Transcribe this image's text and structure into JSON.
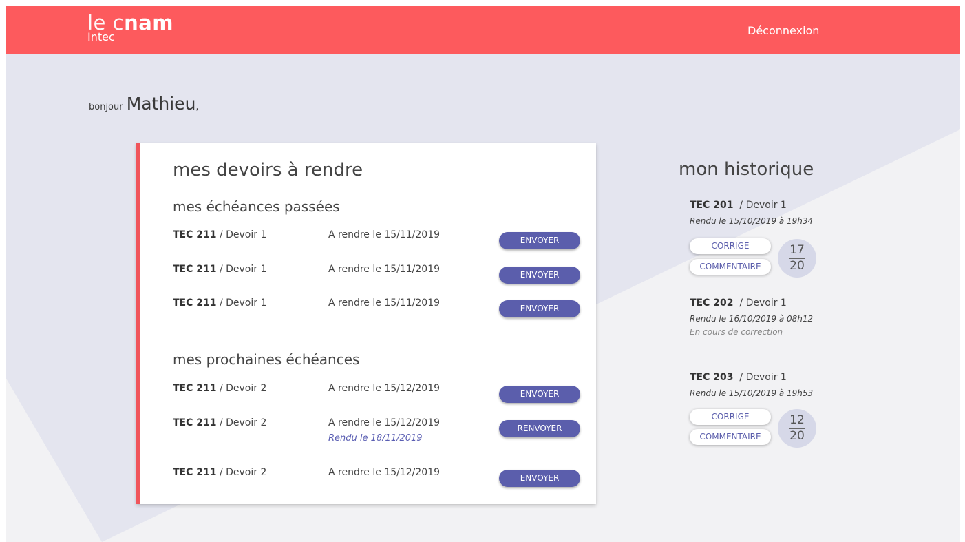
{
  "header": {
    "logo_main_thin": "le c",
    "logo_main_bold": "nam",
    "logo_sub": "Intec",
    "logout_label": "Déconnexion"
  },
  "greeting": {
    "prefix": "bonjour",
    "name": "Mathieu",
    "suffix": ","
  },
  "assignments": {
    "title": "mes devoirs à rendre",
    "past": {
      "title": "mes échéances passées",
      "items": [
        {
          "course": "TEC 211",
          "homework": " / Devoir 1",
          "due": "A rendre le 15/11/2019",
          "button": "ENVOYER"
        },
        {
          "course": "TEC 211",
          "homework": " / Devoir 1",
          "due": "A rendre le 15/11/2019",
          "button": "ENVOYER"
        },
        {
          "course": "TEC 211",
          "homework": " / Devoir 1",
          "due": "A rendre le 15/11/2019",
          "button": "ENVOYER"
        }
      ]
    },
    "upcoming": {
      "title": "mes prochaines échéances",
      "items": [
        {
          "course": "TEC 211",
          "homework": " / Devoir 2",
          "due": "A rendre le 15/12/2019",
          "button": "ENVOYER"
        },
        {
          "course": "TEC 211",
          "homework": " / Devoir 2",
          "due": "A rendre le 15/12/2019",
          "submitted": "Rendu le 18/11/2019",
          "button": "RENVOYER"
        },
        {
          "course": "TEC 211",
          "homework": " / Devoir 2",
          "due": "A rendre le 15/12/2019",
          "button": "ENVOYER"
        }
      ]
    }
  },
  "history": {
    "title": "mon historique",
    "items": [
      {
        "course": "TEC 201",
        "homework": "/  Devoir 1",
        "date": "Rendu le 15/10/2019 à 19h34",
        "corrige": "CORRIGE",
        "commentaire": "COMMENTAIRE",
        "grade": "17",
        "max": "20"
      },
      {
        "course": "TEC 202",
        "homework": "/  Devoir 1",
        "date": "Rendu le 16/10/2019 à 08h12",
        "status": "En cours de correction"
      },
      {
        "course": "TEC 203",
        "homework": "/  Devoir 1",
        "date": "Rendu le 15/10/2019 à 19h53",
        "corrige": "CORRIGE",
        "commentaire": "COMMENTAIRE",
        "grade": "12",
        "max": "20"
      }
    ]
  },
  "colors": {
    "header": "#fd5a5d",
    "accent": "#5b5eac",
    "background": "#e4e5ef"
  }
}
